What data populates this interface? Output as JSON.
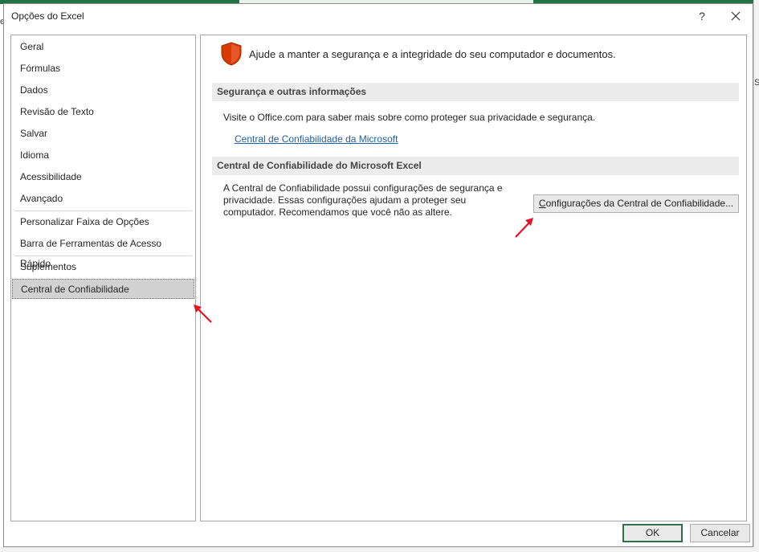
{
  "window": {
    "title": "Opções do Excel",
    "help": "?"
  },
  "background": {
    "right_letter": "S",
    "left_letter": "e"
  },
  "nav": {
    "items": [
      "Geral",
      "Fórmulas",
      "Dados",
      "Revisão de Texto",
      "Salvar",
      "Idioma",
      "Acessibilidade",
      "Avançado",
      "Personalizar Faixa de Opções",
      "Barra de Ferramentas de Acesso Rápido",
      "Suplementos",
      "Central de Confiabilidade"
    ],
    "selected": "Central de Confiabilidade"
  },
  "content": {
    "headline": "Ajude a manter a segurança e a integridade do seu computador e documentos.",
    "section1": {
      "header": "Segurança e outras informações",
      "text": "Visite o Office.com para saber mais sobre como proteger sua privacidade e segurança.",
      "link": "Central de Confiabilidade da Microsoft"
    },
    "section2": {
      "header": "Central de Confiabilidade do Microsoft Excel",
      "description": "A Central de Confiabilidade possui configurações de segurança e privacidade. Essas configurações ajudam a proteger seu computador. Recomendamos que você não as altere.",
      "button_first": "C",
      "button_rest": "onfigurações da Central de Confiabilidade..."
    }
  },
  "footer": {
    "ok": "OK",
    "cancel": "Cancelar"
  },
  "colors": {
    "accent": "#217346",
    "shield": "#d83b01",
    "link": "#1f5fa8",
    "annotation_arrow": "#e81123"
  },
  "icons": [
    "shield-icon",
    "close-icon",
    "help-icon",
    "arrow-annotation-icon"
  ]
}
